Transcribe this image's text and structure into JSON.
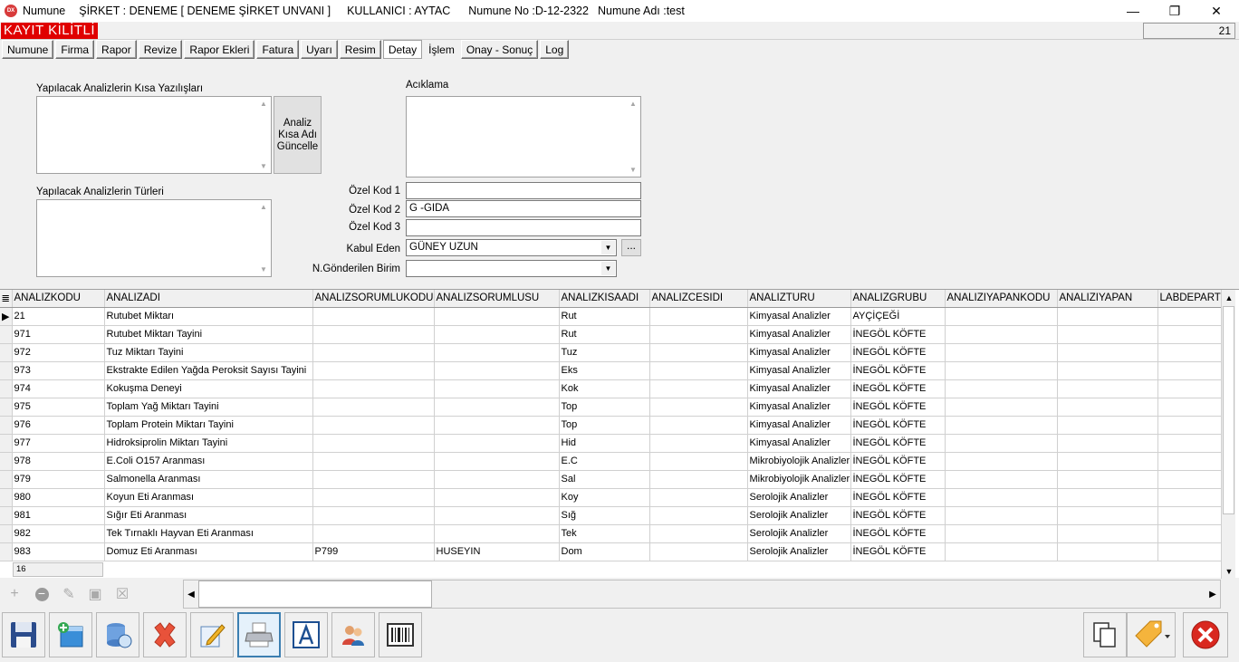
{
  "window": {
    "app_logo": "DX",
    "title_app": "Numune",
    "title_company": "ŞİRKET : DENEME [ DENEME ŞİRKET UNVANI ]",
    "title_user": "KULLANICI : AYTAC",
    "title_sample_no": "Numune No :D-12-2322",
    "title_sample_name": "Numune Adı :test",
    "minimize_icon": "minimize-icon",
    "restore_icon": "restore-icon",
    "close_icon": "close-icon"
  },
  "status": {
    "locked_label": "KAYIT KİLİTLİ",
    "counter": "21"
  },
  "tabs": [
    "Numune",
    "Firma",
    "Rapor",
    "Revize",
    "Rapor Ekleri",
    "Fatura",
    "Uyarı",
    "Resim",
    "Detay",
    "İşlem",
    "Onay - Sonuç",
    "Log"
  ],
  "active_tab": "Detay",
  "detail": {
    "short_names_label": "Yapılacak Analizlerin Kısa Yazılışları",
    "short_names_value": "",
    "types_label": "Yapılacak Analizlerin Türleri",
    "types_value": "",
    "update_button": "Analiz Kısa Adı Güncelle",
    "description_label": "Acıklama",
    "description_value": "",
    "ozel_kod1_label": "Özel Kod 1",
    "ozel_kod1_value": "",
    "ozel_kod2_label": "Özel Kod 2",
    "ozel_kod2_value": "G -GIDA",
    "ozel_kod3_label": "Özel Kod 3",
    "ozel_kod3_value": "",
    "kabul_eden_label": "Kabul Eden",
    "kabul_eden_value": "GÜNEY UZUN",
    "gonderilen_birim_label": "N.Gönderilen Birim",
    "gonderilen_birim_value": "",
    "ellipsis_button": "..."
  },
  "grid": {
    "columns": [
      "ANALIZKODU",
      "ANALIZADI",
      "ANALIZSORUMLUKODU",
      "ANALIZSORUMLUSU",
      "ANALIZKISAADI",
      "ANALIZCESIDI",
      "ANALIZTURU",
      "ANALIZGRUBU",
      "ANALIZIYAPANKODU",
      "ANALIZIYAPAN",
      "LABDEPARTI"
    ],
    "rows": [
      [
        "21",
        "Rutubet Miktarı",
        "",
        "",
        "Rut",
        "",
        "Kimyasal Analizler",
        "AYÇİÇEĞİ",
        "",
        "",
        ""
      ],
      [
        "971",
        "Rutubet Miktarı Tayini",
        "",
        "",
        "Rut",
        "",
        "Kimyasal Analizler",
        "İNEGÖL KÖFTE",
        "",
        "",
        ""
      ],
      [
        "972",
        "Tuz Miktarı Tayini",
        "",
        "",
        "Tuz",
        "",
        "Kimyasal Analizler",
        "İNEGÖL KÖFTE",
        "",
        "",
        ""
      ],
      [
        "973",
        "Ekstrakte Edilen Yağda Peroksit Sayısı Tayini",
        "",
        "",
        "Eks",
        "",
        "Kimyasal Analizler",
        "İNEGÖL KÖFTE",
        "",
        "",
        ""
      ],
      [
        "974",
        "Kokuşma Deneyi",
        "",
        "",
        "Kok",
        "",
        "Kimyasal Analizler",
        "İNEGÖL KÖFTE",
        "",
        "",
        ""
      ],
      [
        "975",
        "Toplam Yağ Miktarı Tayini",
        "",
        "",
        "Top",
        "",
        "Kimyasal Analizler",
        "İNEGÖL KÖFTE",
        "",
        "",
        ""
      ],
      [
        "976",
        "Toplam Protein Miktarı Tayini",
        "",
        "",
        "Top",
        "",
        "Kimyasal Analizler",
        "İNEGÖL KÖFTE",
        "",
        "",
        ""
      ],
      [
        "977",
        "Hidroksiprolin Miktarı Tayini",
        "",
        "",
        "Hid",
        "",
        "Kimyasal Analizler",
        "İNEGÖL KÖFTE",
        "",
        "",
        ""
      ],
      [
        "978",
        "E.Coli O157 Aranması",
        "",
        "",
        "E.C",
        "",
        "Mikrobiyolojik Analizler",
        "İNEGÖL KÖFTE",
        "",
        "",
        ""
      ],
      [
        "979",
        "Salmonella Aranması",
        "",
        "",
        "Sal",
        "",
        "Mikrobiyolojik Analizler",
        "İNEGÖL KÖFTE",
        "",
        "",
        ""
      ],
      [
        "980",
        "Koyun Eti Aranması",
        "",
        "",
        "Koy",
        "",
        "Serolojik Analizler",
        "İNEGÖL KÖFTE",
        "",
        "",
        ""
      ],
      [
        "981",
        "Sığır Eti Aranması",
        "",
        "",
        "Sığ",
        "",
        "Serolojik Analizler",
        "İNEGÖL KÖFTE",
        "",
        "",
        ""
      ],
      [
        "982",
        "Tek Tırnaklı Hayvan Eti Aranması",
        "",
        "",
        "Tek",
        "",
        "Serolojik Analizler",
        "İNEGÖL KÖFTE",
        "",
        "",
        ""
      ],
      [
        "983",
        "Domuz Eti Aranması",
        "P799",
        "HUSEYIN",
        "Dom",
        "",
        "Serolojik Analizler",
        "İNEGÖL KÖFTE",
        "",
        "",
        ""
      ]
    ],
    "footer_count": "16"
  },
  "navigator_icons": [
    "add-icon",
    "delete-icon",
    "edit-icon",
    "save-icon",
    "cancel-icon"
  ],
  "toolbar_icons": [
    "save-icon",
    "new-record-icon",
    "database-icon",
    "delete-icon",
    "edit-icon",
    "printer-icon",
    "text-icon",
    "users-icon",
    "barcode-icon",
    "copy-icon",
    "tag-icon",
    "exit-icon"
  ],
  "colors": {
    "locked_bg": "#e00000",
    "exit_red": "#d9281f",
    "selected_border": "#3c7fb1"
  }
}
